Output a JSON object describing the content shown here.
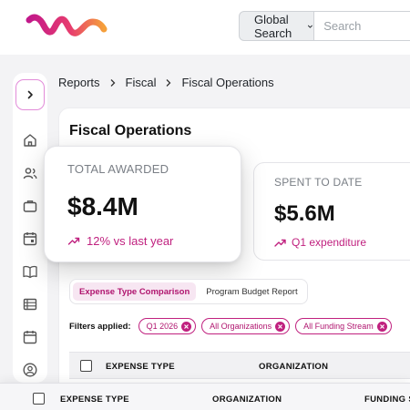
{
  "search": {
    "scope_label": "Global Search",
    "placeholder": "Search"
  },
  "breadcrumb": [
    "Reports",
    "Fiscal",
    "Fiscal Operations"
  ],
  "page": {
    "title": "Fiscal Operations"
  },
  "kpis": {
    "awarded": {
      "label": "TOTAL AWARDED",
      "value": "$8.4M",
      "delta": "12% vs last year"
    },
    "spent": {
      "label": "SPENT TO DATE",
      "value": "$5.6M",
      "delta": "Q1 expenditure"
    }
  },
  "tabs": [
    {
      "label": "Expense Type Comparison",
      "active": true
    },
    {
      "label": "Program Budget Report",
      "active": false
    }
  ],
  "filters": {
    "label": "Filters applied:",
    "chips": [
      "Q1 2026",
      "All Organizations",
      "All Funding Stream"
    ]
  },
  "table_inner": {
    "columns": [
      "EXPENSE TYPE",
      "ORGANIZATION"
    ]
  },
  "table_outer": {
    "columns": [
      "EXPENSE TYPE",
      "ORGANIZATION",
      "FUNDING S"
    ]
  },
  "colors": {
    "accent": "#c0217f",
    "accent_bg": "#f7e6f2"
  }
}
